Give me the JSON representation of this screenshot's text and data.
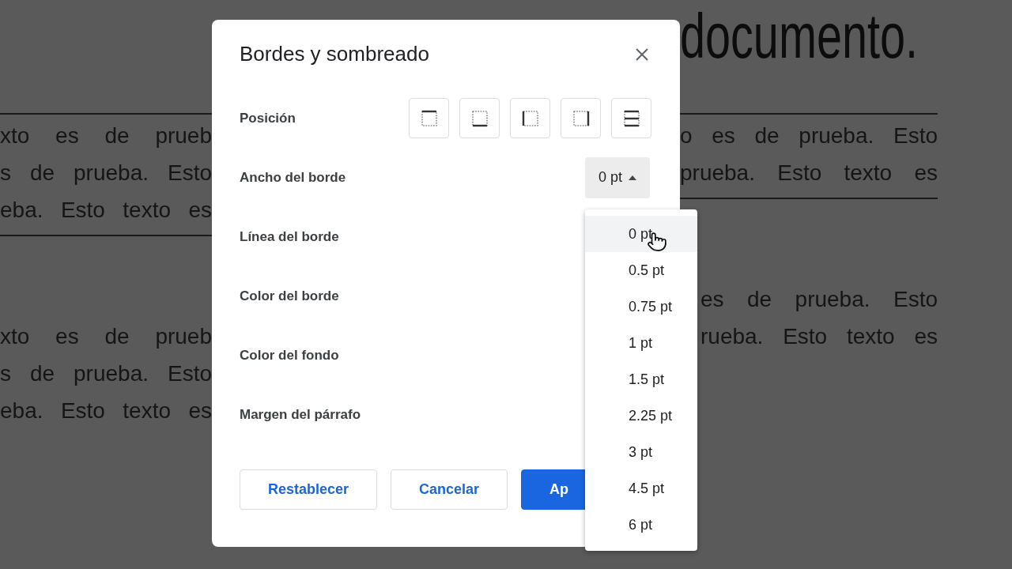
{
  "document": {
    "title": "documento.",
    "paragraphs": [
      {
        "left": [
          "xto es de prueb",
          "s de prueba. Esto",
          "eba. Esto texto es"
        ],
        "right": [
          "o es de prueba. Esto",
          "prueba. Esto texto es"
        ],
        "ruled": true
      },
      {
        "left": [
          "xto es de prueb",
          "s de prueba. Esto",
          "eba. Esto texto es"
        ],
        "right": [
          "es de prueba. Esto",
          "rueba. Esto texto es"
        ],
        "ruled": false
      }
    ]
  },
  "dialog": {
    "title": "Bordes y sombreado",
    "rows": [
      {
        "kind": "positions",
        "label": "Posición",
        "positions": [
          {
            "kind": "top"
          },
          {
            "kind": "bottom"
          },
          {
            "kind": "left"
          },
          {
            "kind": "right"
          },
          {
            "kind": "between"
          }
        ]
      },
      {
        "kind": "dropdown",
        "label": "Ancho del borde",
        "value": "0 pt",
        "expanded": true
      },
      {
        "kind": "plain",
        "label": "Línea del borde"
      },
      {
        "kind": "plain",
        "label": "Color del borde"
      },
      {
        "kind": "plain",
        "label": "Color del fondo"
      },
      {
        "kind": "plain",
        "label": "Margen del párrafo"
      }
    ],
    "buttons": [
      {
        "label": "Restablecer",
        "primary": false
      },
      {
        "label": "Cancelar",
        "primary": false
      },
      {
        "label": "Ap",
        "primary": true
      }
    ]
  },
  "menu": {
    "items": [
      {
        "label": "0 pt",
        "highlighted": true
      },
      {
        "label": "0.5 pt",
        "highlighted": false
      },
      {
        "label": "0.75 pt",
        "highlighted": false
      },
      {
        "label": "1 pt",
        "highlighted": false
      },
      {
        "label": "1.5 pt",
        "highlighted": false
      },
      {
        "label": "2.25 pt",
        "highlighted": false
      },
      {
        "label": "3 pt",
        "highlighted": false
      },
      {
        "label": "4.5 pt",
        "highlighted": false
      },
      {
        "label": "6 pt",
        "highlighted": false
      }
    ]
  }
}
